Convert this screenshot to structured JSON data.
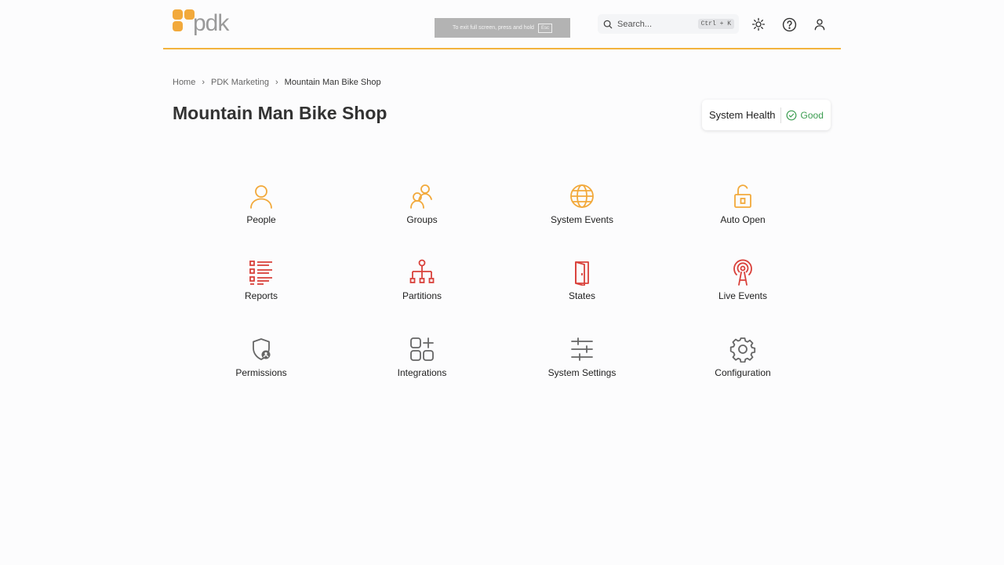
{
  "brand": {
    "logo_text": "pdk",
    "accent": "#f2b33d"
  },
  "fullscreen_notice": {
    "message": "To exit full screen, press and hold",
    "key": "Esc"
  },
  "search": {
    "placeholder": "Search...",
    "shortcut": "Ctrl + K",
    "icon": "search-icon"
  },
  "header_icons": [
    "sun-icon",
    "help-icon",
    "user-icon"
  ],
  "breadcrumb": {
    "items": [
      "Home",
      "PDK Marketing",
      "Mountain Man Bike Shop"
    ]
  },
  "page_title": "Mountain Man Bike Shop",
  "system_health": {
    "label": "System Health",
    "status": "Good",
    "status_color": "#3a9c4f"
  },
  "tiles": [
    {
      "label": "People",
      "icon": "person-icon",
      "color": "#f2a93b"
    },
    {
      "label": "Groups",
      "icon": "group-icon",
      "color": "#f2a93b"
    },
    {
      "label": "System Events",
      "icon": "globe-icon",
      "color": "#f2a93b"
    },
    {
      "label": "Auto Open",
      "icon": "unlock-icon",
      "color": "#f2a93b"
    },
    {
      "label": "Reports",
      "icon": "list-icon",
      "color": "#d9403a"
    },
    {
      "label": "Partitions",
      "icon": "hierarchy-icon",
      "color": "#d9403a"
    },
    {
      "label": "States",
      "icon": "door-icon",
      "color": "#d9403a"
    },
    {
      "label": "Live Events",
      "icon": "broadcast-icon",
      "color": "#d9403a"
    },
    {
      "label": "Permissions",
      "icon": "shield-user-icon",
      "color": "#666666"
    },
    {
      "label": "Integrations",
      "icon": "apps-add-icon",
      "color": "#666666"
    },
    {
      "label": "System Settings",
      "icon": "sliders-icon",
      "color": "#666666"
    },
    {
      "label": "Configuration",
      "icon": "gear-icon",
      "color": "#666666"
    }
  ]
}
